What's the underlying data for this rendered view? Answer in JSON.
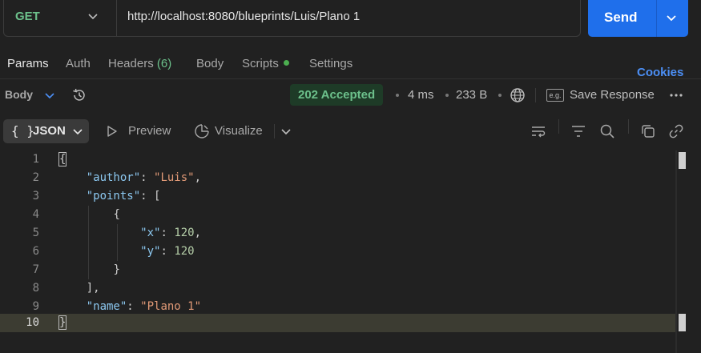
{
  "request": {
    "method": "GET",
    "url": "http://localhost:8080/blueprints/Luis/Plano 1",
    "send_label": "Send"
  },
  "tabs": [
    {
      "label": "Params",
      "active": true
    },
    {
      "label": "Auth"
    },
    {
      "label": "Headers",
      "count": "(6)"
    },
    {
      "label": "Body"
    },
    {
      "label": "Scripts",
      "has_dot": true
    },
    {
      "label": "Settings"
    }
  ],
  "cookies_label": "Cookies",
  "response": {
    "body_label": "Body",
    "status": "202 Accepted",
    "time": "4 ms",
    "size": "233 B",
    "save_label": "Save Response",
    "eg_label": "e.g."
  },
  "view": {
    "format_braces": "{ }",
    "format_label": "JSON",
    "preview_label": "Preview",
    "visualize_label": "Visualize"
  },
  "editor": {
    "line_numbers": [
      "1",
      "2",
      "3",
      "4",
      "5",
      "6",
      "7",
      "8",
      "9",
      "10"
    ],
    "current_line": "10",
    "json": {
      "author_key": "\"author\"",
      "author_value": "\"Luis\"",
      "points_key": "\"points\"",
      "x_key": "\"x\"",
      "x_value": "120",
      "y_key": "\"y\"",
      "y_value": "120",
      "name_key": "\"name\"",
      "name_value": "\"Plano 1\""
    }
  },
  "colors": {
    "background": "#212121",
    "accent": "#1f6feb",
    "success": "#6cc08b",
    "json_key": "#8cc8f0",
    "json_string": "#e29a77",
    "json_number": "#b5cea8"
  }
}
